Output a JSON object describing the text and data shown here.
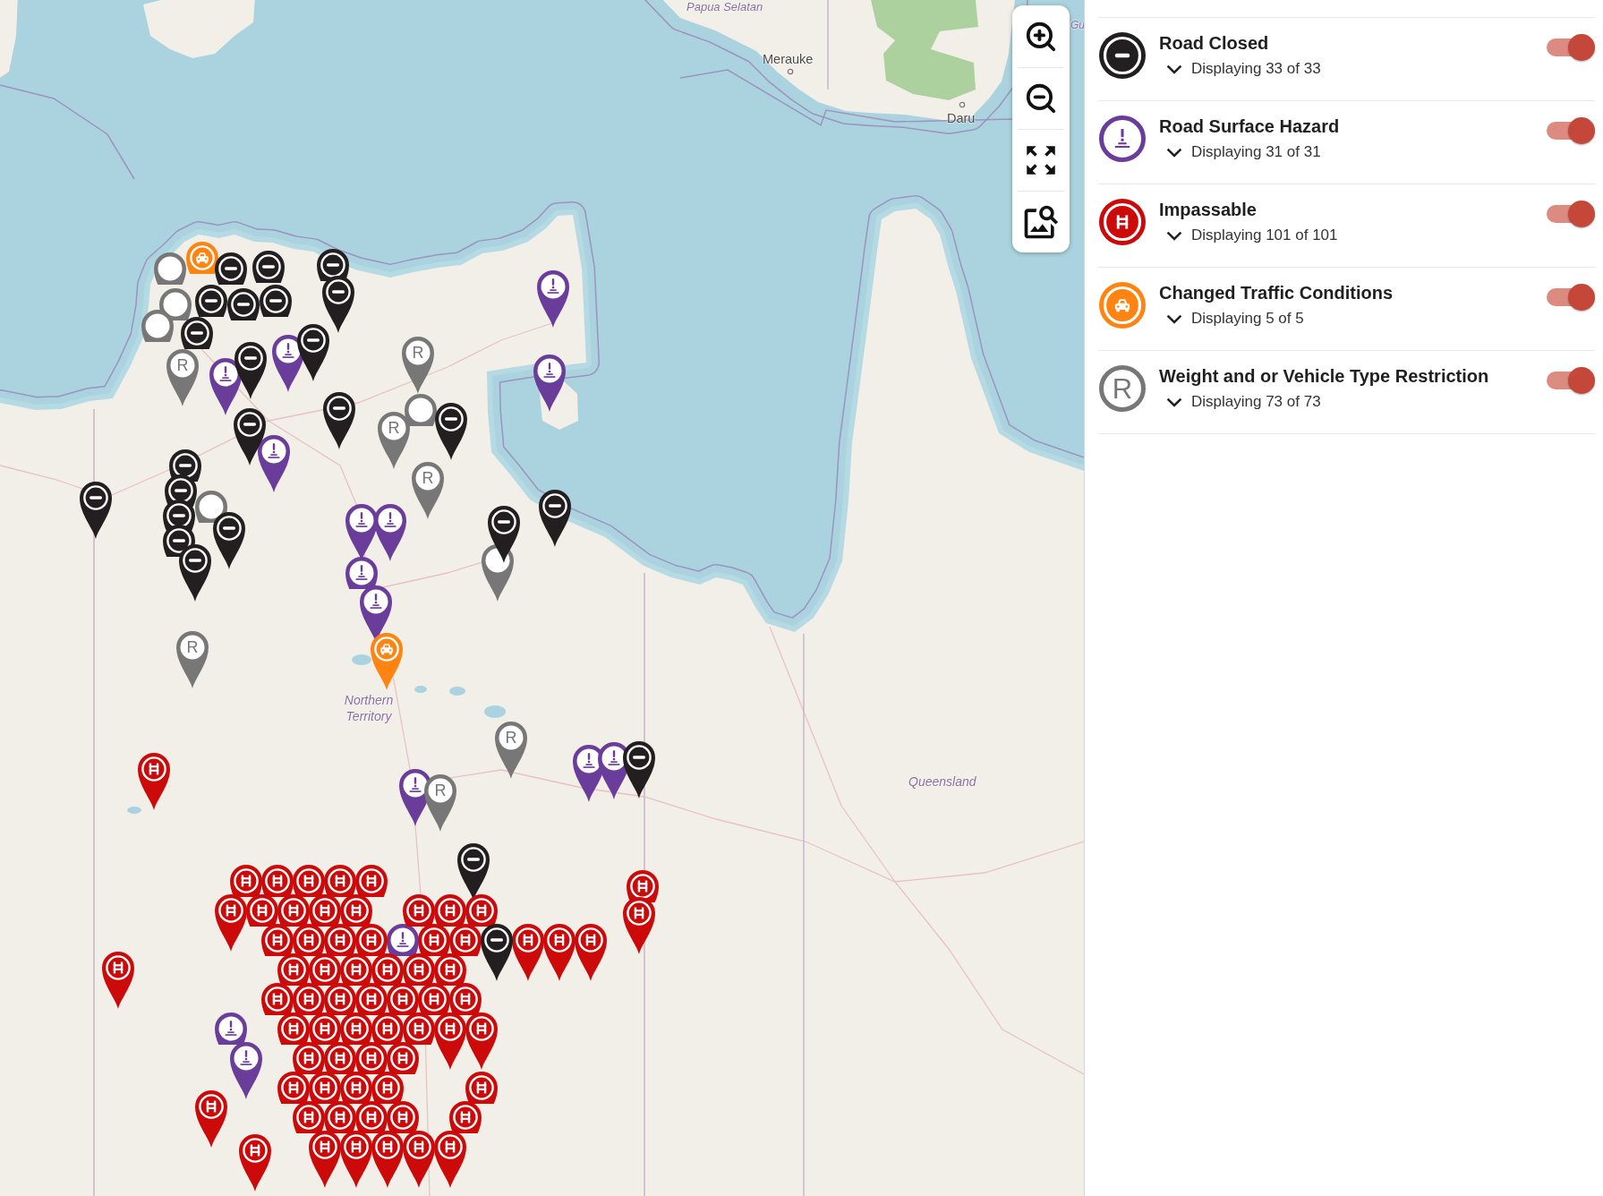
{
  "map": {
    "place_labels": [
      {
        "text": "Papua Selatan",
        "kind": "region"
      },
      {
        "text": "Gu",
        "kind": "region"
      },
      {
        "text": "Merauke",
        "kind": "town"
      },
      {
        "text": "Daru",
        "kind": "town"
      },
      {
        "text": "Northern Territory",
        "kind": "region"
      },
      {
        "text": "Queensland",
        "kind": "region"
      }
    ],
    "pins": [
      {
        "kind": "restriction"
      },
      {
        "kind": "restriction"
      },
      {
        "kind": "restriction"
      },
      {
        "kind": "traffic"
      },
      {
        "kind": "closed"
      },
      {
        "kind": "closed"
      },
      {
        "kind": "closed"
      },
      {
        "kind": "closed"
      },
      {
        "kind": "closed"
      },
      {
        "kind": "closed"
      },
      {
        "kind": "closed"
      },
      {
        "kind": "closed"
      },
      {
        "kind": "restriction",
        "symbol": "R"
      },
      {
        "kind": "hazard"
      },
      {
        "kind": "closed"
      },
      {
        "kind": "hazard"
      },
      {
        "kind": "closed"
      },
      {
        "kind": "restriction",
        "symbol": "R"
      },
      {
        "kind": "hazard"
      },
      {
        "kind": "hazard"
      },
      {
        "kind": "closed"
      },
      {
        "kind": "restriction"
      },
      {
        "kind": "restriction",
        "symbol": "R"
      },
      {
        "kind": "restriction",
        "symbol": "R"
      },
      {
        "kind": "closed"
      },
      {
        "kind": "hazard"
      },
      {
        "kind": "closed"
      },
      {
        "kind": "closed"
      },
      {
        "kind": "closed"
      },
      {
        "kind": "closed"
      },
      {
        "kind": "restriction"
      },
      {
        "kind": "closed"
      },
      {
        "kind": "closed"
      },
      {
        "kind": "closed"
      },
      {
        "kind": "closed"
      },
      {
        "kind": "hazard"
      },
      {
        "kind": "hazard"
      },
      {
        "kind": "restriction"
      },
      {
        "kind": "closed"
      },
      {
        "kind": "closed"
      },
      {
        "kind": "hazard"
      },
      {
        "kind": "hazard"
      },
      {
        "kind": "traffic"
      },
      {
        "kind": "restriction",
        "symbol": "R"
      },
      {
        "kind": "restriction",
        "symbol": "R"
      },
      {
        "kind": "hazard"
      },
      {
        "kind": "hazard"
      },
      {
        "kind": "closed"
      },
      {
        "kind": "hazard"
      },
      {
        "kind": "restriction",
        "symbol": "R"
      },
      {
        "kind": "impassable"
      },
      {
        "kind": "impassable"
      },
      {
        "kind": "impassable"
      },
      {
        "kind": "impassable"
      },
      {
        "kind": "impassable"
      },
      {
        "kind": "impassable"
      },
      {
        "kind": "impassable"
      },
      {
        "kind": "impassable"
      },
      {
        "kind": "closed"
      },
      {
        "kind": "impassable"
      },
      {
        "kind": "impassable"
      },
      {
        "kind": "impassable"
      },
      {
        "kind": "impassable"
      },
      {
        "kind": "impassable"
      },
      {
        "kind": "hazard"
      },
      {
        "kind": "impassable"
      },
      {
        "kind": "impassable"
      },
      {
        "kind": "impassable"
      },
      {
        "kind": "impassable"
      },
      {
        "kind": "impassable"
      },
      {
        "kind": "impassable"
      },
      {
        "kind": "impassable"
      },
      {
        "kind": "impassable"
      },
      {
        "kind": "impassable"
      },
      {
        "kind": "impassable"
      },
      {
        "kind": "impassable"
      },
      {
        "kind": "impassable"
      },
      {
        "kind": "impassable"
      },
      {
        "kind": "impassable"
      },
      {
        "kind": "closed"
      },
      {
        "kind": "impassable"
      },
      {
        "kind": "impassable"
      },
      {
        "kind": "impassable"
      },
      {
        "kind": "impassable"
      },
      {
        "kind": "impassable"
      },
      {
        "kind": "impassable"
      },
      {
        "kind": "impassable"
      },
      {
        "kind": "impassable"
      },
      {
        "kind": "impassable"
      },
      {
        "kind": "impassable"
      },
      {
        "kind": "impassable"
      },
      {
        "kind": "impassable"
      },
      {
        "kind": "impassable"
      },
      {
        "kind": "impassable"
      },
      {
        "kind": "impassable"
      },
      {
        "kind": "impassable"
      },
      {
        "kind": "impassable"
      },
      {
        "kind": "impassable"
      },
      {
        "kind": "impassable"
      },
      {
        "kind": "hazard"
      },
      {
        "kind": "hazard"
      },
      {
        "kind": "impassable"
      },
      {
        "kind": "impassable"
      },
      {
        "kind": "impassable"
      },
      {
        "kind": "impassable"
      },
      {
        "kind": "impassable"
      },
      {
        "kind": "impassable"
      },
      {
        "kind": "impassable"
      },
      {
        "kind": "impassable"
      },
      {
        "kind": "impassable"
      },
      {
        "kind": "impassable"
      },
      {
        "kind": "impassable"
      },
      {
        "kind": "impassable"
      },
      {
        "kind": "impassable"
      },
      {
        "kind": "impassable"
      },
      {
        "kind": "impassable"
      },
      {
        "kind": "impassable"
      },
      {
        "kind": "impassable"
      },
      {
        "kind": "impassable"
      },
      {
        "kind": "impassable"
      },
      {
        "kind": "impassable"
      },
      {
        "kind": "impassable"
      }
    ]
  },
  "layers": [
    {
      "kind": "closed",
      "title": "Road Closed",
      "count": "Displaying 33 of 33",
      "on": true
    },
    {
      "kind": "hazard",
      "title": "Road Surface Hazard",
      "count": "Displaying 31 of 31",
      "on": true
    },
    {
      "kind": "impassable",
      "title": "Impassable",
      "count": "Displaying 101 of 101",
      "on": true
    },
    {
      "kind": "traffic",
      "title": "Changed Traffic Conditions",
      "count": "Displaying 5 of 5",
      "on": true
    },
    {
      "kind": "restriction",
      "symbol": "R",
      "title": "Weight and or Vehicle Type Restriction",
      "count": "Displaying 73 of 73",
      "on": true
    }
  ]
}
